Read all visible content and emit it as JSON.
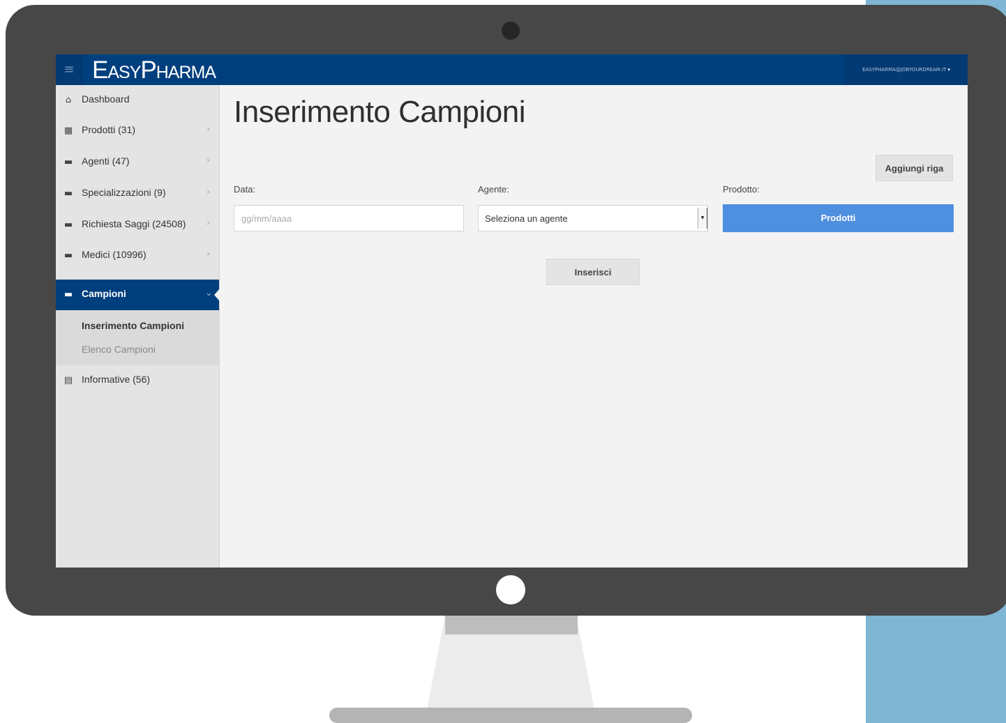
{
  "app": {
    "brand": "EasyPharma",
    "user_email": "EASYPHARMA@JOBYOURDREAM.IT",
    "menu_toggle_icon": "≡",
    "user_caret_icon": "▾"
  },
  "colors": {
    "topbar": "#003f7e",
    "active_nav": "#003f7e",
    "primary_button": "#4f8fdf",
    "sidebar_bg": "#e4e4e4",
    "content_bg": "#f3f3f3",
    "background_panel": "#7fb6d4"
  },
  "sidebar": {
    "items": [
      {
        "label": "Dashboard",
        "icon": "home-icon",
        "glyph": "⌂",
        "chevron": ""
      },
      {
        "label": "Prodotti (31)",
        "icon": "grid-icon",
        "glyph": "▦",
        "chevron": "›"
      },
      {
        "label": "Agenti (47)",
        "icon": "briefcase-icon",
        "glyph": "▬",
        "chevron": "›"
      },
      {
        "label": "Specializzazioni (9)",
        "icon": "briefcase-icon",
        "glyph": "▬",
        "chevron": "›"
      },
      {
        "label": "Richiesta Saggi (24508)",
        "icon": "briefcase-icon",
        "glyph": "▬",
        "chevron": "›"
      },
      {
        "label": "Medici (10996)",
        "icon": "briefcase-icon",
        "glyph": "▬",
        "chevron": "›"
      },
      {
        "label": "Campioni",
        "icon": "briefcase-icon",
        "glyph": "▬",
        "chevron": "⌄"
      },
      {
        "label": "Informative (56)",
        "icon": "document-icon",
        "glyph": "▤",
        "chevron": ""
      }
    ],
    "submenu": {
      "current": "Inserimento Campioni",
      "other": "Elenco Campioni"
    }
  },
  "main": {
    "title": "Inserimento Campioni",
    "add_row_label": "Aggiungi riga",
    "date_label": "Data:",
    "date_placeholder": "gg/mm/aaaa",
    "agent_label": "Agente:",
    "agent_selected": "Seleziona un agente",
    "product_label": "Prodotto:",
    "products_button": "Prodotti",
    "insert_button": "Inserisci"
  }
}
